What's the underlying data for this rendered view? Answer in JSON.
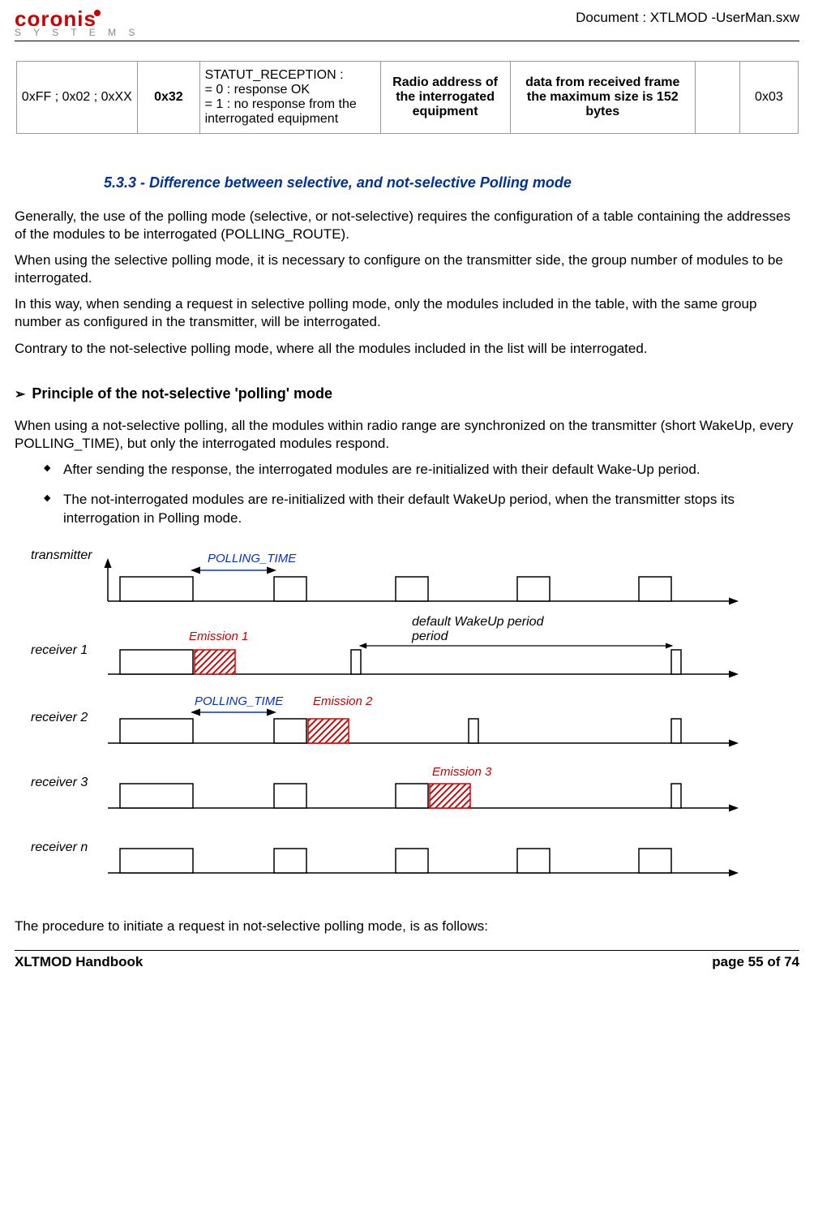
{
  "header": {
    "logo_brand": "coronis",
    "logo_sub": "S Y S T E M S",
    "doc_title": "Document : XTLMOD -UserMan.sxw"
  },
  "frame_table": {
    "c1": "0xFF ; 0x02 ; 0xXX",
    "c2": "0x32",
    "c3_l1": "STATUT_RECEPTION :",
    "c3_l2": "= 0 : response OK",
    "c3_l3": "= 1 : no response from the interrogated equipment",
    "c4": "Radio address of the interrogated equipment",
    "c5_l1": "data from received frame",
    "c5_l2": "the maximum size  is 152 bytes",
    "c6": "",
    "c7": "0x03"
  },
  "section": {
    "title": "5.3.3 - Difference between selective, and not-selective Polling mode",
    "p1": "Generally, the use of the polling mode (selective, or not-selective) requires the configuration of a table containing the addresses of the modules to be interrogated (POLLING_ROUTE).",
    "p2": "When using the selective polling mode, it is necessary to configure on the transmitter side, the group number of modules to be interrogated.",
    "p3": "In this way, when sending a request in selective polling mode, only the modules included in the table, with the same group number as configured in the transmitter, will be interrogated.",
    "p4": "Contrary to the not-selective polling mode, where all the modules included in the list will be interrogated."
  },
  "principle": {
    "chev": "➢",
    "head": "Principle of the not-selective 'polling' mode",
    "intro": "When using a not-selective polling, all the modules within radio range are synchronized on the transmitter (short WakeUp, every POLLING_TIME), but only the interrogated modules respond.",
    "b1": "After sending the response, the interrogated modules are re-initialized with their default Wake-Up period.",
    "b2": "The not-interrogated modules are re-initialized with their default WakeUp period, when the transmitter stops its interrogation in Polling mode."
  },
  "diagram": {
    "transmitter": "transmitter",
    "r1": "receiver 1",
    "r2": "receiver 2",
    "r3": "receiver 3",
    "rn": "receiver n",
    "poll_time": "POLLING_TIME",
    "em1": "Emission 1",
    "em2": "Emission 2",
    "em3": "Emission 3",
    "wakeup": "default WakeUp period"
  },
  "closing": "The procedure to initiate a request in not-selective polling mode, is as follows:",
  "footer": {
    "left": "XLTMOD Handbook",
    "right": "page 55 of 74"
  }
}
